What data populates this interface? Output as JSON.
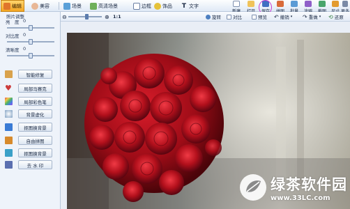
{
  "tabs": [
    {
      "label": "编辑",
      "icon": "edit-icon",
      "active": true
    },
    {
      "label": "美容",
      "icon": "face-icon",
      "active": false
    },
    {
      "label": "场景",
      "icon": "scene-icon",
      "active": false
    },
    {
      "label": "高清场景",
      "icon": "hd-scene-icon",
      "active": false
    },
    {
      "label": "边框",
      "icon": "frame-icon",
      "active": false
    },
    {
      "label": "饰品",
      "icon": "accessory-icon",
      "active": false
    },
    {
      "label": "文字",
      "icon": "text-icon",
      "active": false
    }
  ],
  "tools": [
    {
      "label": "新建",
      "icon": "new-icon"
    },
    {
      "label": "打开",
      "icon": "open-icon"
    },
    {
      "label": "保存",
      "icon": "save-icon",
      "highlighted": true
    },
    {
      "label": "拼图",
      "icon": "puzzle-icon"
    },
    {
      "label": "批量",
      "icon": "batch-icon"
    },
    {
      "label": "涂鸦",
      "icon": "doodle-icon"
    },
    {
      "label": "截图",
      "icon": "screenshot-icon"
    },
    {
      "label": "尺寸",
      "icon": "size-icon"
    },
    {
      "label": "更多",
      "icon": "more-icon"
    }
  ],
  "toolbar2": {
    "zoom_out_icon": "zoom-out-icon",
    "zoom_in_icon": "zoom-in-icon",
    "zoom_ratio": "1:1",
    "zoom_level": 0.55,
    "rotate": "旋转",
    "compare": "对比",
    "preview": "预览",
    "undo": "撤销",
    "redo": "重做",
    "restore": "还原"
  },
  "panel": {
    "title": "照片调整",
    "adjustments": [
      {
        "label": "亮　度",
        "value": "0",
        "level": 0.5
      },
      {
        "label": "对比度",
        "value": "0",
        "level": 0.5
      },
      {
        "label": "清晰度",
        "value": "0",
        "level": 0.5
      }
    ],
    "effects": [
      {
        "label": "智能修复",
        "icon": "smart-fix-icon",
        "color": "#d9a24c"
      },
      {
        "label": "局部马赛克",
        "icon": "mosaic-icon",
        "color": "#cc3b3b"
      },
      {
        "label": "局部彩色笔",
        "icon": "color-pen-icon",
        "color": "#7a3fb3"
      },
      {
        "label": "背景虚化",
        "icon": "blur-icon",
        "color": "#4a9a6a"
      },
      {
        "label": "抠图换背景",
        "icon": "cutout-icon",
        "color": "#3a7bd5"
      },
      {
        "label": "自由拼图",
        "icon": "free-puzzle-icon",
        "color": "#d78a2c"
      },
      {
        "label": "抠图换背景",
        "icon": "bg-swap-icon",
        "color": "#3aa0c8"
      },
      {
        "label": "去 水 印",
        "icon": "watermark-remove-icon",
        "color": "#5a6fb0"
      }
    ]
  },
  "watermark": {
    "text": "绿茶软件园",
    "url": "www.33LC.com"
  },
  "colors": {
    "accent": "#f4a623",
    "highlight_ring": "#c33bd0",
    "rose": "#b3101c"
  }
}
